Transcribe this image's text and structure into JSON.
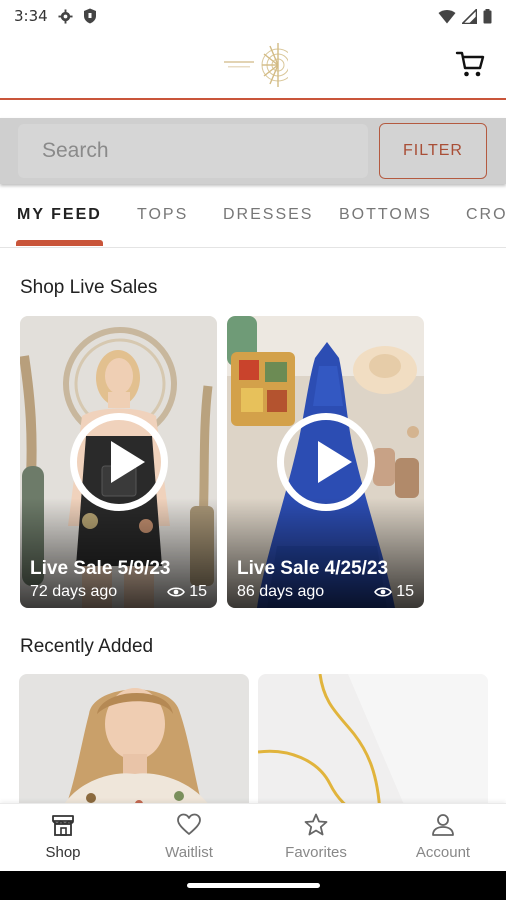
{
  "status_bar": {
    "time": "3:34"
  },
  "search": {
    "placeholder": "Search",
    "filter_label": "FILTER"
  },
  "tabs": [
    {
      "label": "MY FEED",
      "active": true
    },
    {
      "label": "TOPS",
      "active": false
    },
    {
      "label": "DRESSES",
      "active": false
    },
    {
      "label": "BOTTOMS",
      "active": false
    },
    {
      "label": "CRO",
      "active": false
    }
  ],
  "live_sales": {
    "title": "Shop Live Sales",
    "items": [
      {
        "title": "Live Sale 5/9/23",
        "age": "72 days ago",
        "views": "15"
      },
      {
        "title": "Live Sale 4/25/23",
        "age": "86 days ago",
        "views": "15"
      }
    ]
  },
  "recently_added": {
    "title": "Recently Added"
  },
  "bottom_nav": [
    {
      "label": "Shop",
      "icon": "shop-icon",
      "active": true
    },
    {
      "label": "Waitlist",
      "icon": "heart-icon",
      "active": false
    },
    {
      "label": "Favorites",
      "icon": "star-icon",
      "active": false
    },
    {
      "label": "Account",
      "icon": "person-icon",
      "active": false
    }
  ],
  "colors": {
    "accent": "#c9553a",
    "filter_text": "#a94e36",
    "search_band": "#cfcfcf"
  }
}
